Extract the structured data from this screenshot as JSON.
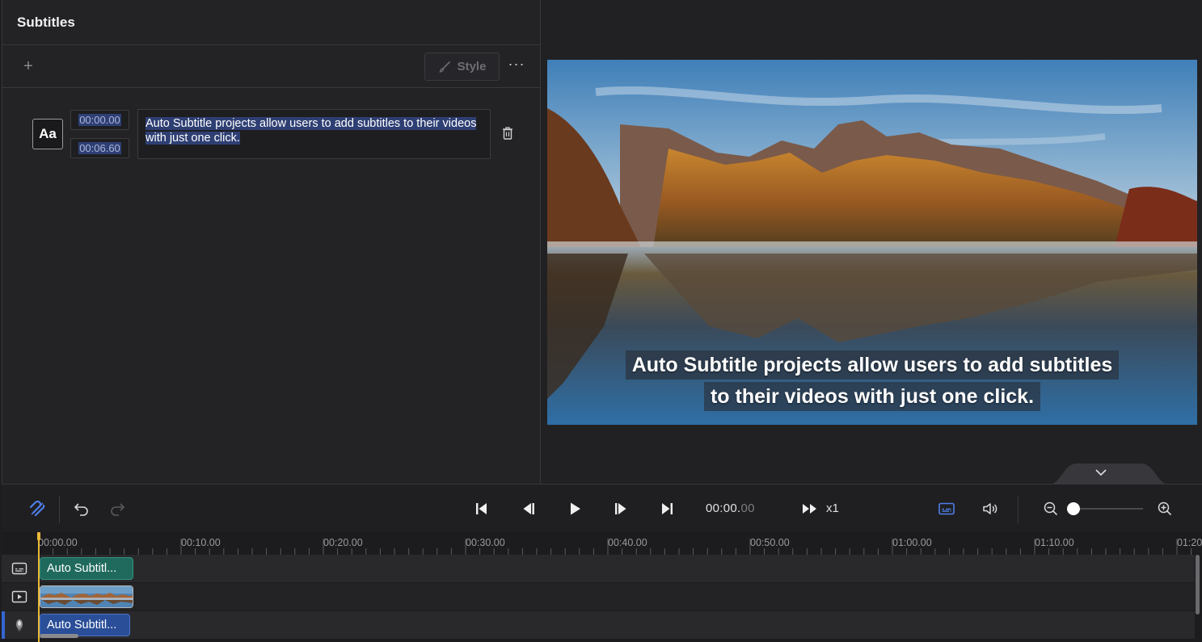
{
  "panel": {
    "title": "Subtitles",
    "add_label": "+",
    "style_label": "Style",
    "more_label": "···"
  },
  "subtitles": [
    {
      "style_label": "Aa",
      "start": "00:00.00",
      "end": "00:06.60",
      "text": "Auto Subtitle projects allow users to add subtitles to their videos with just one click."
    }
  ],
  "preview": {
    "caption_line1": "Auto Subtitle projects allow users to add subtitles",
    "caption_line2": "to their videos with just one click."
  },
  "transport": {
    "timecode_main": "00:00.",
    "timecode_frac": "00",
    "speed": "x1",
    "zoom_level": 0
  },
  "timeline": {
    "ruler_labels": [
      "00:00.00",
      "00:10.00",
      "00:20.00",
      "00:30.00",
      "00:40.00",
      "00:50.00",
      "01:00.00",
      "01:10.00",
      "01:20"
    ],
    "subtitle_clip_label": "Auto Subtitl...",
    "audio_clip_label": "Auto Subtitl..."
  },
  "icons": {
    "add": "plus-icon",
    "style": "brush-icon",
    "more": "more-horizontal-icon",
    "delete": "trash-icon",
    "magnet": "magnet-icon",
    "undo": "undo-icon",
    "redo": "redo-icon",
    "skip_start": "skip-to-start-icon",
    "prev_frame": "previous-frame-icon",
    "play": "play-icon",
    "next_frame": "next-frame-icon",
    "skip_end": "skip-to-end-icon",
    "fast_forward": "fast-forward-icon",
    "captions": "captions-icon",
    "volume": "volume-icon",
    "zoom_out": "zoom-out-icon",
    "zoom_in": "zoom-in-icon"
  },
  "colors": {
    "accent": "#3b6fdc",
    "subtitle_clip": "#1f6a5d",
    "audio_clip": "#2a4e98",
    "playhead": "#e8b838",
    "selection": "#2e3f73"
  }
}
